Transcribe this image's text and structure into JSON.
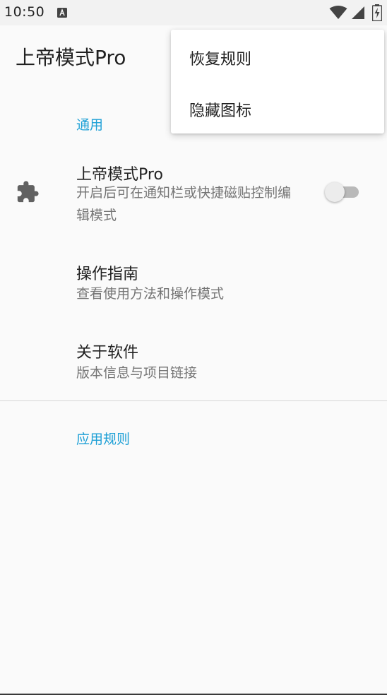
{
  "status_bar": {
    "time": "10:50",
    "notification_icon": "a-notification-icon",
    "wifi_icon": "wifi-icon",
    "signal_icon": "cell-signal-icon",
    "battery_icon": "battery-charging-icon"
  },
  "app_bar": {
    "title": "上帝模式Pro"
  },
  "menu": {
    "items": [
      {
        "label": "恢复规则"
      },
      {
        "label": "隐藏图标"
      }
    ]
  },
  "sections": {
    "general": {
      "header": "通用",
      "items": [
        {
          "title": "上帝模式Pro",
          "summary": "开启后可在通知栏或快捷磁贴控制编辑模式",
          "icon": "puzzle-piece-icon",
          "switch_on": false
        },
        {
          "title": "操作指南",
          "summary": "查看使用方法和操作模式"
        },
        {
          "title": "关于软件",
          "summary": "版本信息与项目链接"
        }
      ]
    },
    "app_rules": {
      "header": "应用规则"
    }
  },
  "colors": {
    "accent": "#1ea0d6",
    "background": "#fafafa",
    "primary_text": "#212121",
    "secondary_text": "#757575"
  }
}
